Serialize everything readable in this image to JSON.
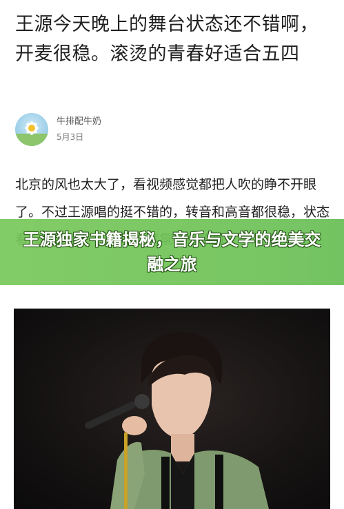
{
  "article": {
    "title": "王源今天晚上的舞台状态还不错啊，开麦很稳。滚烫的青春好适合五四",
    "author": {
      "name": "牛排配牛奶",
      "date": "5月3日"
    },
    "body": "北京的风也太大了，看视频感觉都把人吹的睁不开眼了。不过王源唱的挺不错的，转音和高音都很稳，状态看起来也很好，现场的气氛都很热血，很燃"
  },
  "banner": {
    "text": "王源独家书籍揭秘，音乐与文学的绝美交融之旅"
  },
  "icons": {
    "avatar": "flower-avatar-icon"
  }
}
